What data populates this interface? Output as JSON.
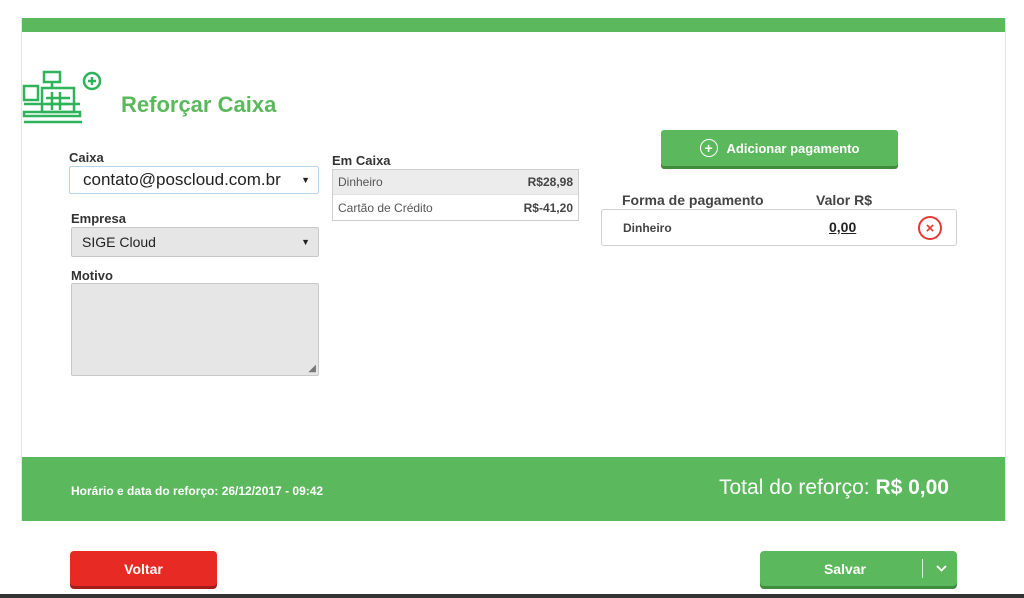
{
  "header": {
    "title": "Reforçar Caixa",
    "icon": "cash-register-add-icon"
  },
  "form": {
    "caixa_label": "Caixa",
    "caixa_value": "contato@poscloud.com.br",
    "empresa_label": "Empresa",
    "empresa_value": "SIGE Cloud",
    "motivo_label": "Motivo",
    "motivo_value": ""
  },
  "em_caixa": {
    "label": "Em Caixa",
    "rows": [
      {
        "name": "Dinheiro",
        "value": "R$28,98"
      },
      {
        "name": "Cartão de Crédito",
        "value": "R$-41,20"
      }
    ]
  },
  "payments": {
    "add_button_label": "Adicionar pagamento",
    "col_forma": "Forma de pagamento",
    "col_valor": "Valor R$",
    "rows": [
      {
        "forma": "Dinheiro",
        "valor": "0,00"
      }
    ]
  },
  "footer": {
    "timestamp_text": "Horário e data do reforço: 26/12/2017 - 09:42",
    "total_label": "Total do reforço:",
    "total_value": "R$ 0,00"
  },
  "actions": {
    "back_label": "Voltar",
    "save_label": "Salvar"
  },
  "colors": {
    "primary": "#5cb85c",
    "danger": "#e82a25"
  }
}
